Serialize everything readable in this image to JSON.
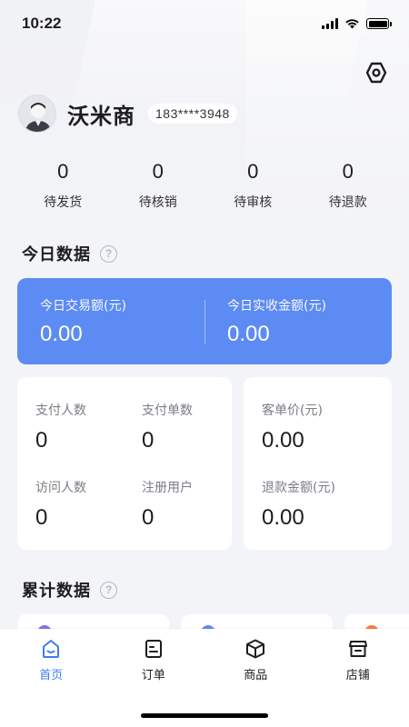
{
  "status_bar": {
    "time": "10:22"
  },
  "profile": {
    "store_name": "沃米商",
    "phone": "183****3948"
  },
  "order_stats": [
    {
      "value": "0",
      "label": "待发货"
    },
    {
      "value": "0",
      "label": "待核销"
    },
    {
      "value": "0",
      "label": "待审核"
    },
    {
      "value": "0",
      "label": "待退款"
    }
  ],
  "today": {
    "title": "今日数据",
    "help_icon": "?",
    "highlight": [
      {
        "label": "今日交易额(元)",
        "value": "0.00"
      },
      {
        "label": "今日实收金额(元)",
        "value": "0.00"
      }
    ],
    "left_stats": [
      {
        "label": "支付人数",
        "value": "0"
      },
      {
        "label": "支付单数",
        "value": "0"
      },
      {
        "label": "访问人数",
        "value": "0"
      },
      {
        "label": "注册用户",
        "value": "0"
      }
    ],
    "right_stats": [
      {
        "label": "客单价(元)",
        "value": "0.00"
      },
      {
        "label": "退款金额(元)",
        "value": "0.00"
      }
    ]
  },
  "cumulative": {
    "title": "累计数据",
    "help_icon": "?"
  },
  "tabs": [
    {
      "label": "首页",
      "icon": "home-icon",
      "active": true
    },
    {
      "label": "订单",
      "icon": "order-icon",
      "active": false
    },
    {
      "label": "商品",
      "icon": "product-box-icon",
      "active": false
    },
    {
      "label": "店铺",
      "icon": "store-icon",
      "active": false
    }
  ],
  "colors": {
    "accent": "#3e7cf5",
    "highlight_card": "#5d8bf4",
    "peek_purple": "#8b6cf0",
    "peek_blue": "#5d8bf4",
    "peek_orange": "#f57c3d"
  }
}
